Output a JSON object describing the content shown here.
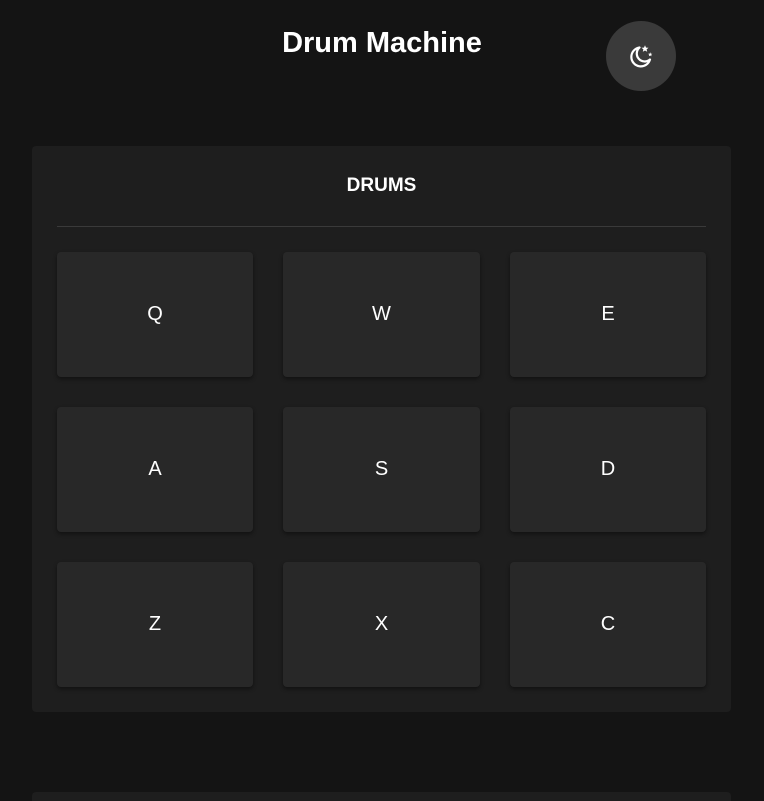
{
  "header": {
    "title": "Drum Machine",
    "theme_toggle_icon": "moon-stars-icon"
  },
  "drum_panel": {
    "title": "DRUMS",
    "pads": [
      {
        "key": "Q"
      },
      {
        "key": "W"
      },
      {
        "key": "E"
      },
      {
        "key": "A"
      },
      {
        "key": "S"
      },
      {
        "key": "D"
      },
      {
        "key": "Z"
      },
      {
        "key": "X"
      },
      {
        "key": "C"
      }
    ]
  },
  "colors": {
    "background": "#141414",
    "panel": "#1e1e1e",
    "pad": "#282828",
    "toggle": "#3a3a3a",
    "text": "#ffffff"
  }
}
